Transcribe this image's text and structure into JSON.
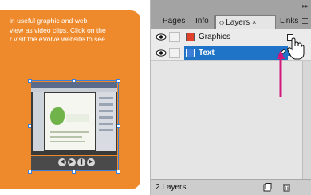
{
  "document": {
    "caption_lines": [
      "in useful graphic and web",
      "view as video clips.  Click on the",
      "r visit the eVolve website to see"
    ],
    "accent_color": "#ef8a2c"
  },
  "layers_panel": {
    "tabs": [
      {
        "label": "Pages"
      },
      {
        "label": "Info"
      },
      {
        "label": "Layers",
        "active": true
      },
      {
        "label": "Links"
      }
    ],
    "layers": [
      {
        "name": "Graphics",
        "color": "#e0412d",
        "visible": true,
        "selected": false
      },
      {
        "name": "Text",
        "color": "#3a7fd5",
        "visible": true,
        "selected": true
      }
    ],
    "footer": {
      "count_text": "2 Layers"
    },
    "selection_color": "#1f74c8",
    "icons": [
      "eye-icon",
      "lock-box",
      "pen-icon",
      "hand-cursor-icon",
      "new-layer-icon",
      "trash-icon",
      "panel-menu-icon"
    ]
  }
}
